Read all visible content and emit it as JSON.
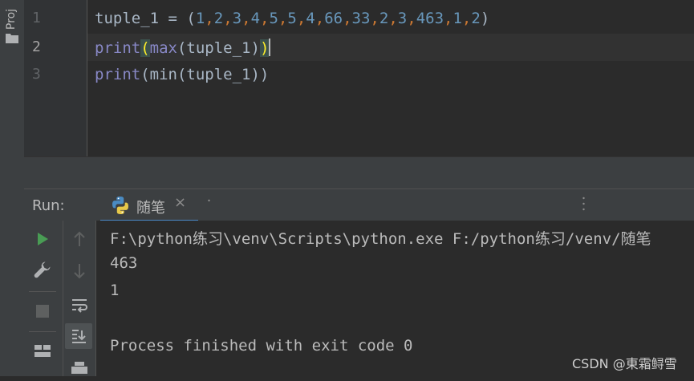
{
  "sidebar": {
    "project_label": "Proj"
  },
  "editor": {
    "line_numbers": [
      "1",
      "2",
      "3"
    ],
    "lines": [
      {
        "var": "tuple_1",
        "assign": " = (",
        "numbers": [
          "1",
          "2",
          "3",
          "4",
          "5",
          "5",
          "4",
          "66",
          "33",
          "2",
          "3",
          "463",
          "1",
          "2"
        ],
        "close": ")"
      },
      {
        "func": "print",
        "open": "(",
        "inner_func": "max",
        "inner_args": "(tuple_1)",
        "close": ")"
      },
      {
        "func": "print",
        "rest": "(min(tuple_1))"
      }
    ]
  },
  "run_panel": {
    "label": "Run:",
    "tab_label": "随笔",
    "close_glyph": "×",
    "output_lines": [
      "F:\\python练习\\venv\\Scripts\\python.exe F:/python练习/venv/随笔",
      "463",
      "1",
      "",
      "Process finished with exit code 0"
    ]
  },
  "watermark": "CSDN @東霜鲟雪",
  "colors": {
    "background": "#2b2b2b",
    "keyword": "#8888c6",
    "number": "#6897bb",
    "comma": "#cc7832",
    "bracket_highlight": "#ffef28",
    "run_green": "#499c54",
    "tab_underline": "#4a88c7"
  }
}
